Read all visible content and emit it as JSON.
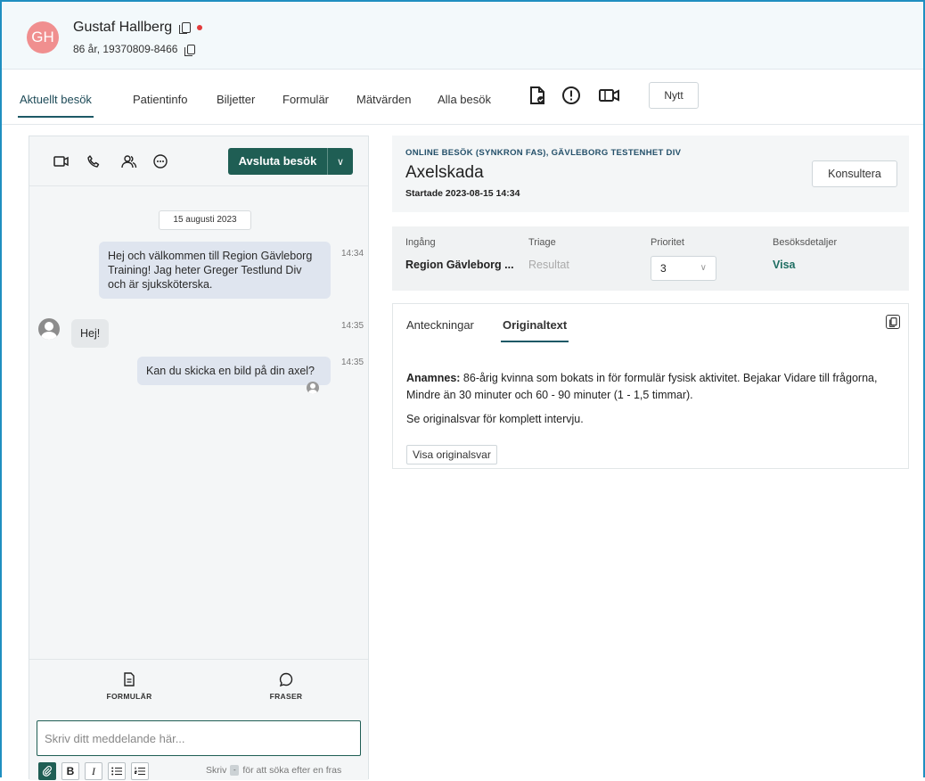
{
  "patient": {
    "initials": "GH",
    "name": "Gustaf Hallberg",
    "age_pnr": "86 år, 19370809-8466"
  },
  "tabs": [
    "Aktuellt besök",
    "Patientinfo",
    "Biljetter",
    "Formulär",
    "Mätvärden",
    "Alla besök"
  ],
  "new_button": "Nytt",
  "chat": {
    "end_visit": "Avsluta besök",
    "date": "15 augusti 2023",
    "messages": [
      {
        "text": "Hej och välkommen till Region Gävleborg Training! Jag heter Greger Testlund Div och är sjuksköterska.",
        "time": "14:34",
        "direction": "out"
      },
      {
        "text": "Hej!",
        "time": "14:35",
        "direction": "in"
      },
      {
        "text": "Kan du skicka en bild på din axel?",
        "time": "14:35",
        "direction": "out"
      }
    ],
    "bottom_buttons": {
      "forms": "FORMULÄR",
      "phrases": "FRASER"
    },
    "composer_placeholder": "Skriv ditt meddelande här...",
    "hint_before": "Skriv",
    "hint_key": "-",
    "hint_after": "för att söka efter en fras"
  },
  "visit": {
    "kicker": "ONLINE BESÖK (SYNKRON FAS), GÄVLEBORG TESTENHET DIV",
    "title": "Axelskada",
    "started": "Startade 2023-08-15 14:34",
    "consult_button": "Konsultera"
  },
  "info": {
    "entry_label": "Ingång",
    "entry_value": "Region Gävleborg ...",
    "triage_label": "Triage",
    "triage_value": "Resultat",
    "priority_label": "Prioritet",
    "priority_value": "3",
    "details_label": "Besöksdetaljer",
    "details_value": "Visa"
  },
  "notes": {
    "tab_notes": "Anteckningar",
    "tab_original": "Originaltext",
    "anamnes_label": "Anamnes:",
    "anamnes_text": " 86-årig kvinna som bokats in för formulär fysisk aktivitet. Bejakar Vidare till frågorna, Mindre än 30 minuter och 60 - 90 minuter (1 - 1,5 timmar).",
    "see_original": "Se originalsvar för komplett intervju.",
    "show_original_button": "Visa originalsvar"
  },
  "colors": {
    "accent": "#1f5e54",
    "frame": "#1f8fc0",
    "avatar": "#f08f8f"
  }
}
